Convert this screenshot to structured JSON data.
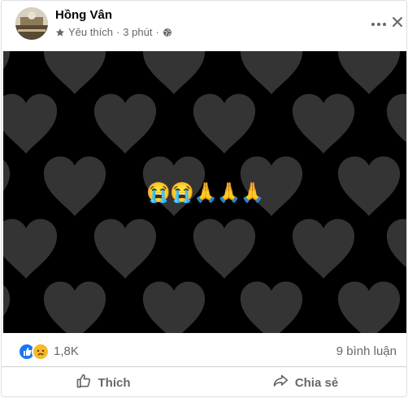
{
  "post": {
    "author": "Hồng Vân",
    "visibility_label": "Yêu thích",
    "separator": "·",
    "time": "3 phút",
    "emojis": "😭😭🙏🙏🙏",
    "reactions_count": "1,8K",
    "comments_label": "9 bình luận"
  },
  "actions": {
    "like": "Thích",
    "share": "Chia sẻ"
  },
  "icons": {
    "more": "more-dots-icon",
    "close": "close-icon",
    "star": "star-icon",
    "globe": "globe-icon",
    "like_reaction": "like-reaction-icon",
    "sad_reaction": "sad-reaction-icon",
    "thumbs_up": "thumbs-up-icon",
    "share": "share-arrow-icon"
  },
  "colors": {
    "background": "#000000",
    "heart": "#3a3a3a",
    "like_blue": "#1877f2",
    "sad_yellow": "#f7b928",
    "secondary_text": "#65676b"
  }
}
